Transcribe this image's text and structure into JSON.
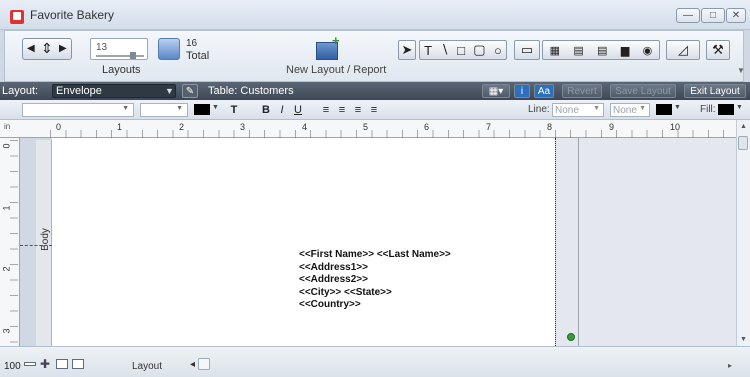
{
  "window": {
    "title": "Favorite Bakery"
  },
  "status_toolbar": {
    "current_layout_number": "13",
    "layouts_label": "Layouts",
    "total_count": "16",
    "total_label": "Total",
    "new_layout_label": "New Layout / Report"
  },
  "layout_bar": {
    "layout_label": "Layout:",
    "layout_value": "Envelope",
    "table_label": "Table: Customers",
    "aa_label": "Aa",
    "info_label": "i",
    "revert_label": "Revert",
    "save_label": "Save Layout",
    "exit_label": "Exit Layout"
  },
  "format_bar": {
    "text_tool": "T",
    "bold": "B",
    "italic": "I",
    "underline": "U",
    "line_label": "Line:",
    "line_value": "None",
    "line_style_value": "None",
    "fill_label": "Fill:"
  },
  "ruler": {
    "unit": "in",
    "numbers": [
      "0",
      "1",
      "2",
      "3",
      "4",
      "5",
      "6",
      "7",
      "8",
      "9",
      "10"
    ]
  },
  "vruler": {
    "numbers": [
      "0",
      "1",
      "2",
      "3"
    ]
  },
  "part": {
    "label": "Body"
  },
  "envelope_fields": [
    "<<First Name>> <<Last Name>>",
    "<<Address1>>",
    "<<Address2>>",
    "<<City>> <<State>>",
    "<<Country>>"
  ],
  "bottom_bar": {
    "zoom": "100",
    "mode": "Layout"
  },
  "colors": {
    "layout_bar": "#4a5562",
    "handle": "#3c9a3c"
  }
}
